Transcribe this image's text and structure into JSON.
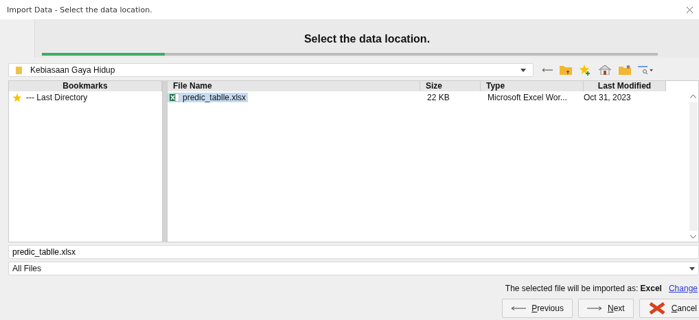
{
  "window": {
    "title": "Import Data - Select the data location."
  },
  "header": {
    "title": "Select the data location.",
    "progress": {
      "level": 0.2
    }
  },
  "location": {
    "value": "Kebiasaan Gaya Hidup"
  },
  "bookmarks": {
    "heading": "Bookmarks",
    "items": [
      {
        "label": "--- Last Directory",
        "selected": false
      }
    ]
  },
  "files": {
    "columns": [
      "File Name",
      "Size",
      "Type",
      "Last Modified"
    ],
    "rows": [
      {
        "name": "predic_tablle.xlsx",
        "size": "22 KB",
        "type": "Microsoft Excel Wor...",
        "modified": "Oct 31, 2023",
        "selected": true
      }
    ]
  },
  "file_name": {
    "value": "predic_tablle.xlsx"
  },
  "filter": {
    "value": "All Files"
  },
  "import_note": {
    "text": "The selected file will be imported as: **Excel**",
    "link": "Change"
  },
  "buttons": [
    {
      "label": "Previous",
      "kind": "previous"
    },
    {
      "label": "Next",
      "kind": "next"
    },
    {
      "label": "Cancel",
      "kind": "cancel"
    }
  ]
}
